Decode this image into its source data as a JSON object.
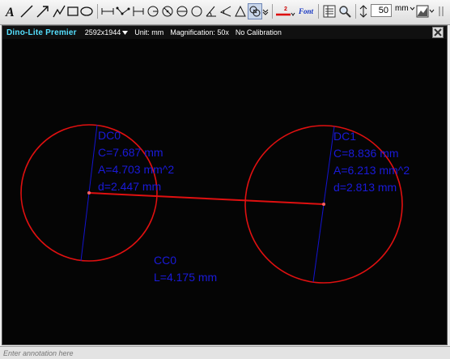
{
  "toolbar": {
    "tools": [
      "text-tool",
      "line-tool",
      "arrow-tool",
      "polyline-tool",
      "rectangle-tool",
      "ellipse-tool",
      "horizontal-measure-tool",
      "polyline-measure-tool",
      "parallel-measure-tool",
      "circle-radius-tool",
      "circle-diameter-tool",
      "circle-3point-tool",
      "angle-tool",
      "triangle-angle-tool",
      "angle-3point-tool",
      "center-to-center-tool",
      "line-color-tool",
      "font-tool",
      "measurement-list-tool",
      "magnifier-tool"
    ],
    "line_weight_label": "2",
    "font_label": "Font",
    "zoom_value": "50",
    "unit": "mm"
  },
  "header": {
    "app_title": "Dino-Lite Premier",
    "resolution": "2592x1944",
    "unit": "Unit: mm",
    "magnification": "Magnification: 50x",
    "calibration": "No Calibration"
  },
  "measurements": {
    "dc0": {
      "name": "DC0",
      "circumference": "C=7.687 mm",
      "area": "A=4.703 mm^2",
      "diameter": "d=2.447 mm"
    },
    "dc1": {
      "name": "DC1",
      "circumference": "C=8.836 mm",
      "area": "A=6.213 mm^2",
      "diameter": "d=2.813 mm"
    },
    "cc0": {
      "name": "CC0",
      "length": "L=4.175 mm"
    }
  },
  "colors": {
    "circle": "#e01010",
    "measure_text": "#1a1ad9",
    "title": "#55e0ff",
    "background": "#050505"
  },
  "status": {
    "annotation_placeholder": "Enter annotation here"
  }
}
